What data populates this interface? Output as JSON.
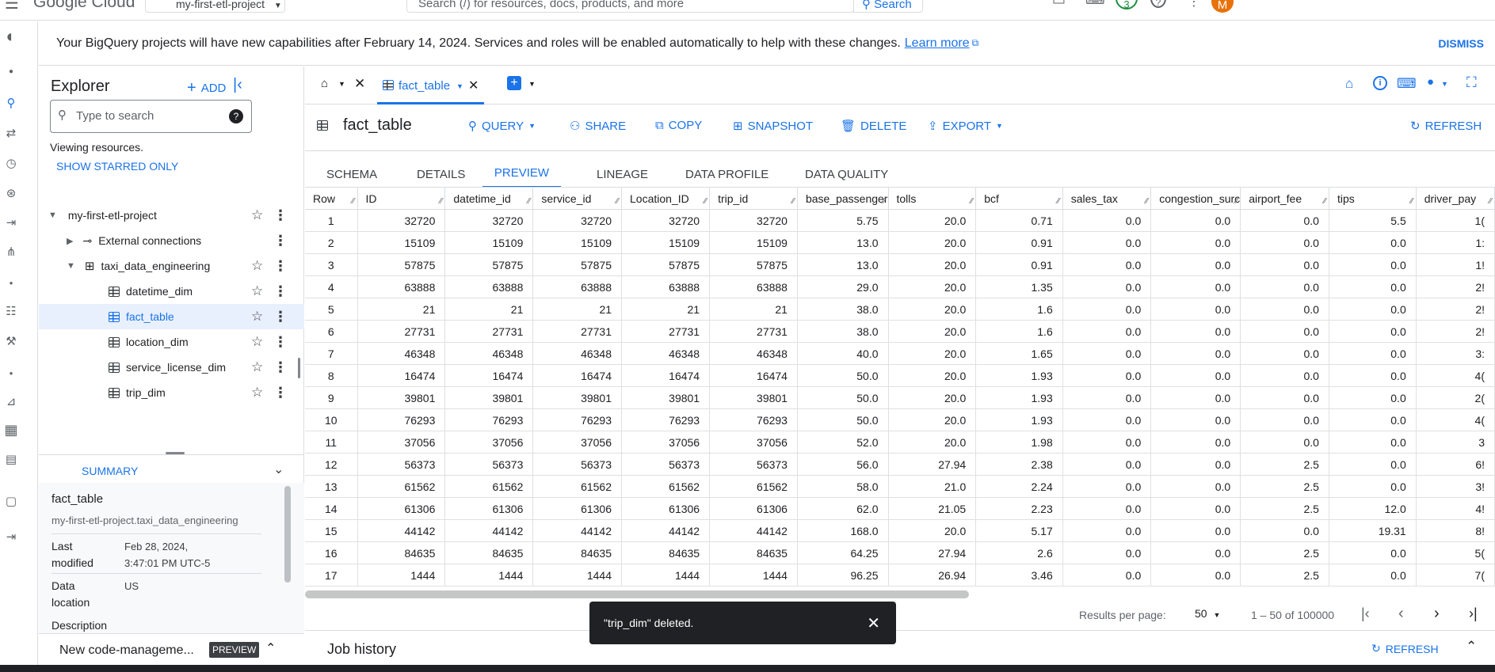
{
  "topbar": {
    "logo": "Google Cloud",
    "project": "my-first-etl-project",
    "search_placeholder": "Search (/) for resources, docs, products, and more",
    "search_button": "Search",
    "notif_count": "3",
    "avatar_letter": "M"
  },
  "banner": {
    "message": "Your BigQuery projects will have new capabilities after February 14, 2024. Services and roles will be enabled automatically to help with these changes.",
    "link": "Learn more",
    "dismiss": "DISMISS"
  },
  "explorer": {
    "title": "Explorer",
    "add": "ADD",
    "search_placeholder": "Type to search",
    "viewing": "Viewing resources.",
    "starred": "SHOW STARRED ONLY",
    "project": "my-first-etl-project",
    "external": "External connections",
    "dataset": "taxi_data_engineering",
    "tables": [
      "datetime_dim",
      "fact_table",
      "location_dim",
      "service_license_dim",
      "trip_dim"
    ],
    "summary_title": "SUMMARY",
    "summary_name": "fact_table",
    "summary_path": "my-first-etl-project.taxi_data_engineering",
    "last_modified_label": "Last modified",
    "last_modified_value": "Feb 28, 2024, 3:47:01 PM UTC-5",
    "data_location_label": "Data location",
    "data_location_value": "US",
    "description_label": "Description",
    "codemgmt": "New code-manageme...",
    "preview_badge": "PREVIEW"
  },
  "tabs_bar": {
    "tab_label": "fact_table"
  },
  "toolbar": {
    "table_name": "fact_table",
    "query": "QUERY",
    "share": "SHARE",
    "copy": "COPY",
    "snapshot": "SNAPSHOT",
    "delete": "DELETE",
    "export": "EXPORT",
    "refresh": "REFRESH"
  },
  "subtabs": [
    "SCHEMA",
    "DETAILS",
    "PREVIEW",
    "LINEAGE",
    "DATA PROFILE",
    "DATA QUALITY"
  ],
  "grid": {
    "columns": [
      "Row",
      "ID",
      "datetime_id",
      "service_id",
      "Location_ID",
      "trip_id",
      "base_passenger",
      "tolls",
      "bcf",
      "sales_tax",
      "congestion_surc",
      "airport_fee",
      "tips",
      "driver_pay"
    ],
    "rows": [
      [
        "1",
        "32720",
        "32720",
        "32720",
        "32720",
        "32720",
        "5.75",
        "20.0",
        "0.71",
        "0.0",
        "0.0",
        "0.0",
        "5.5",
        "1("
      ],
      [
        "2",
        "15109",
        "15109",
        "15109",
        "15109",
        "15109",
        "13.0",
        "20.0",
        "0.91",
        "0.0",
        "0.0",
        "0.0",
        "0.0",
        "1:"
      ],
      [
        "3",
        "57875",
        "57875",
        "57875",
        "57875",
        "57875",
        "13.0",
        "20.0",
        "0.91",
        "0.0",
        "0.0",
        "0.0",
        "0.0",
        "1!"
      ],
      [
        "4",
        "63888",
        "63888",
        "63888",
        "63888",
        "63888",
        "29.0",
        "20.0",
        "1.35",
        "0.0",
        "0.0",
        "0.0",
        "0.0",
        "2!"
      ],
      [
        "5",
        "21",
        "21",
        "21",
        "21",
        "21",
        "38.0",
        "20.0",
        "1.6",
        "0.0",
        "0.0",
        "0.0",
        "0.0",
        "2!"
      ],
      [
        "6",
        "27731",
        "27731",
        "27731",
        "27731",
        "27731",
        "38.0",
        "20.0",
        "1.6",
        "0.0",
        "0.0",
        "0.0",
        "0.0",
        "2!"
      ],
      [
        "7",
        "46348",
        "46348",
        "46348",
        "46348",
        "46348",
        "40.0",
        "20.0",
        "1.65",
        "0.0",
        "0.0",
        "0.0",
        "0.0",
        "3:"
      ],
      [
        "8",
        "16474",
        "16474",
        "16474",
        "16474",
        "16474",
        "50.0",
        "20.0",
        "1.93",
        "0.0",
        "0.0",
        "0.0",
        "0.0",
        "4("
      ],
      [
        "9",
        "39801",
        "39801",
        "39801",
        "39801",
        "39801",
        "50.0",
        "20.0",
        "1.93",
        "0.0",
        "0.0",
        "0.0",
        "0.0",
        "2("
      ],
      [
        "10",
        "76293",
        "76293",
        "76293",
        "76293",
        "76293",
        "50.0",
        "20.0",
        "1.93",
        "0.0",
        "0.0",
        "0.0",
        "0.0",
        "4("
      ],
      [
        "11",
        "37056",
        "37056",
        "37056",
        "37056",
        "37056",
        "52.0",
        "20.0",
        "1.98",
        "0.0",
        "0.0",
        "0.0",
        "0.0",
        "3"
      ],
      [
        "12",
        "56373",
        "56373",
        "56373",
        "56373",
        "56373",
        "56.0",
        "27.94",
        "2.38",
        "0.0",
        "0.0",
        "2.5",
        "0.0",
        "6!"
      ],
      [
        "13",
        "61562",
        "61562",
        "61562",
        "61562",
        "61562",
        "58.0",
        "21.0",
        "2.24",
        "0.0",
        "0.0",
        "2.5",
        "0.0",
        "3!"
      ],
      [
        "14",
        "61306",
        "61306",
        "61306",
        "61306",
        "61306",
        "62.0",
        "21.05",
        "2.23",
        "0.0",
        "0.0",
        "2.5",
        "12.0",
        "4!"
      ],
      [
        "15",
        "44142",
        "44142",
        "44142",
        "44142",
        "44142",
        "168.0",
        "20.0",
        "5.17",
        "0.0",
        "0.0",
        "0.0",
        "19.31",
        "8!"
      ],
      [
        "16",
        "84635",
        "84635",
        "84635",
        "84635",
        "84635",
        "64.25",
        "27.94",
        "2.6",
        "0.0",
        "0.0",
        "2.5",
        "0.0",
        "5("
      ],
      [
        "17",
        "1444",
        "1444",
        "1444",
        "1444",
        "1444",
        "96.25",
        "26.94",
        "3.46",
        "0.0",
        "0.0",
        "2.5",
        "0.0",
        "7("
      ]
    ]
  },
  "pagination": {
    "per_page_label": "Results per page:",
    "per_page": "50",
    "range": "1 – 50 of 100000"
  },
  "toast": {
    "message": "\"trip_dim\" deleted."
  },
  "job_history": {
    "title": "Job history",
    "refresh": "REFRESH"
  },
  "colors": {
    "accent": "#1a73e8",
    "selected_bg": "#e8f0fe"
  }
}
